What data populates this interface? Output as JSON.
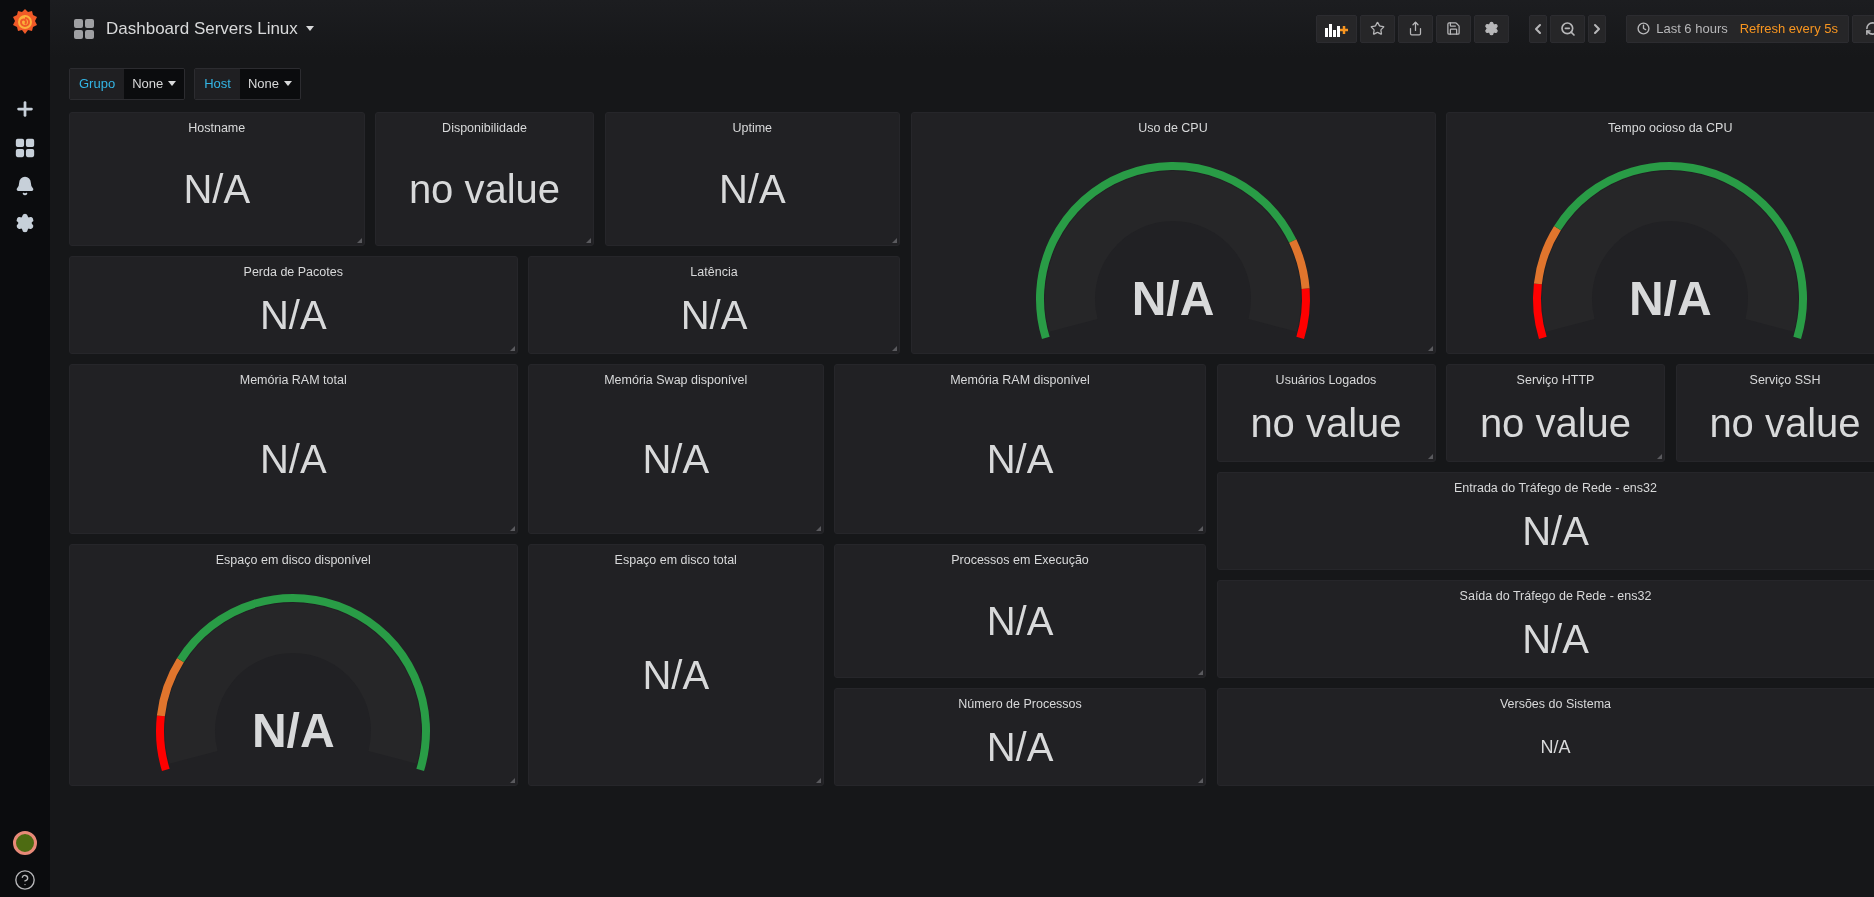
{
  "top_bar": {
    "title": "Dashboard Servers Linux",
    "time_range": "Last 6 hours",
    "refresh": "Refresh every 5s"
  },
  "variables": [
    {
      "label": "Grupo",
      "value": "None"
    },
    {
      "label": "Host",
      "value": "None"
    }
  ],
  "panels": [
    {
      "title": "Hostname",
      "value": "N/A",
      "kind": "stat"
    },
    {
      "title": "Disponibilidade",
      "value": "no value",
      "kind": "stat"
    },
    {
      "title": "Uptime",
      "value": "N/A",
      "kind": "stat"
    },
    {
      "title": "Uso de CPU",
      "value": "N/A",
      "kind": "gauge"
    },
    {
      "title": "Tempo ocioso da CPU",
      "value": "N/A",
      "kind": "rgauge"
    },
    {
      "title": "Perda de Pacotes",
      "value": "N/A",
      "kind": "stat"
    },
    {
      "title": "Latência",
      "value": "N/A",
      "kind": "stat"
    },
    {
      "title": "Memória RAM total",
      "value": "N/A",
      "kind": "stat"
    },
    {
      "title": "Memória Swap disponível",
      "value": "N/A",
      "kind": "stat"
    },
    {
      "title": "Memória RAM disponível",
      "value": "N/A",
      "kind": "stat"
    },
    {
      "title": "Usuários Logados",
      "value": "no value",
      "kind": "stat"
    },
    {
      "title": "Serviço HTTP",
      "value": "no value",
      "kind": "stat"
    },
    {
      "title": "Serviço SSH",
      "value": "no value",
      "kind": "stat"
    },
    {
      "title": "Entrada do Tráfego de Rede - ens32",
      "value": "N/A",
      "kind": "stat"
    },
    {
      "title": "Espaço em disco disponível",
      "value": "N/A",
      "kind": "rgauge"
    },
    {
      "title": "Espaço em disco total",
      "value": "N/A",
      "kind": "stat"
    },
    {
      "title": "Processos em Execução",
      "value": "N/A",
      "kind": "stat"
    },
    {
      "title": "Saída do Tráfego de Rede - ens32",
      "value": "N/A",
      "kind": "stat"
    },
    {
      "title": "Número de Processos",
      "value": "N/A",
      "kind": "stat"
    },
    {
      "title": "Versões do Sistema",
      "value": "N/A",
      "kind": "small"
    }
  ]
}
